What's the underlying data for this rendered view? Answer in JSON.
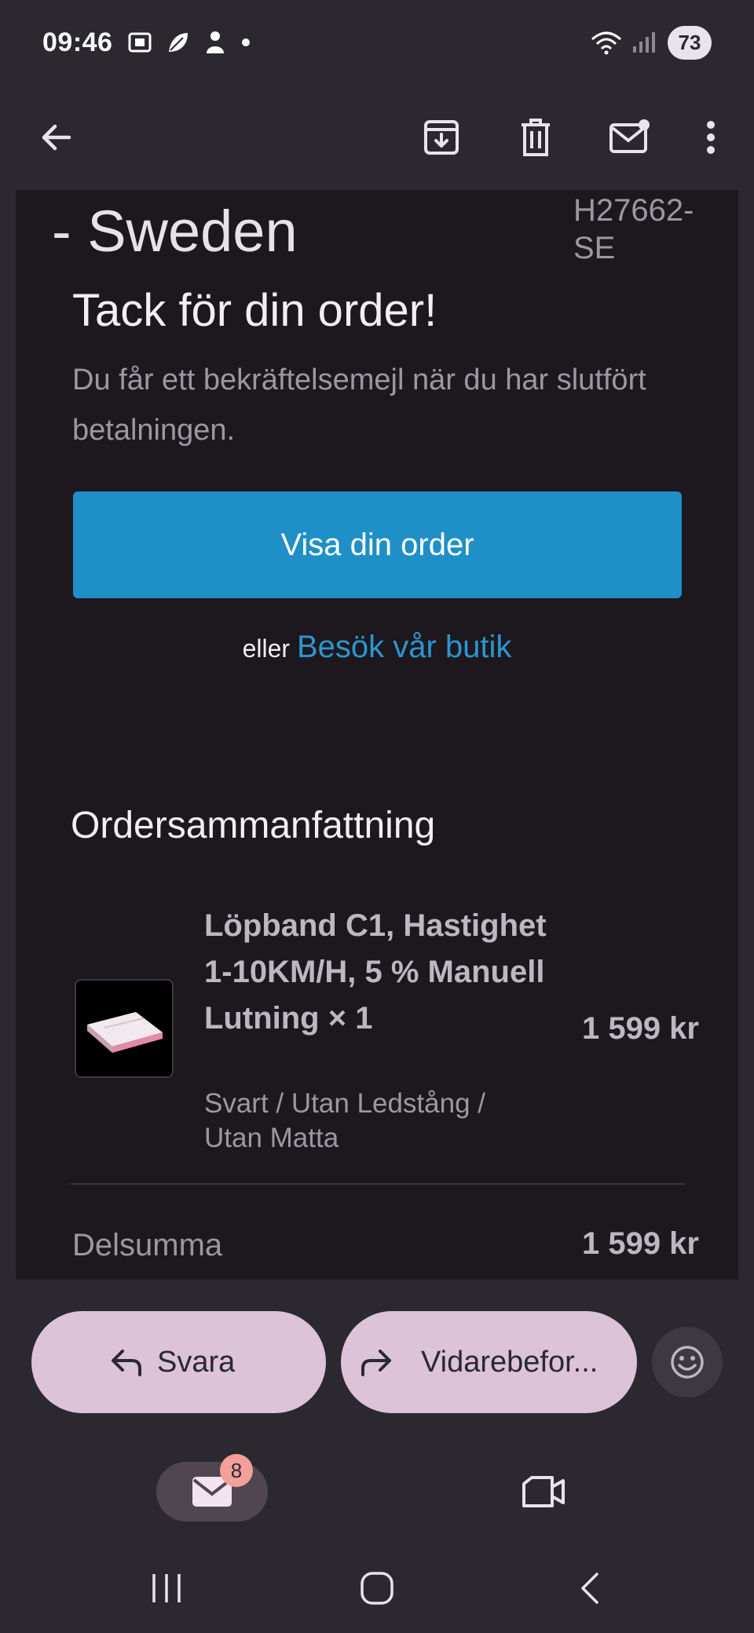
{
  "status_bar": {
    "time": "09:46",
    "battery": "73"
  },
  "app_bar": {
    "icons": [
      "back-arrow-icon",
      "archive-icon",
      "delete-icon",
      "mark-unread-icon",
      "more-options-icon"
    ]
  },
  "email": {
    "store_name": "- Sweden",
    "order_ref": "H27662-SE",
    "heading": "Tack för din order!",
    "info": "Du får ett bekräftelsemejl när du har slutfört betalningen.",
    "cta_label": "Visa din order",
    "alt_prefix": "eller",
    "alt_link": "Besök vår butik",
    "summary_title": "Ordersammanfattning",
    "product": {
      "name": "Löpband C1, Hastighet 1-10KM/H, 5 % Manuell Lutning × 1",
      "variant": "Svart / Utan Ledstång / Utan Matta",
      "price": "1 599 kr"
    },
    "subtotal_label": "Delsumma",
    "subtotal_value": "1 599 kr"
  },
  "reply_bar": {
    "reply_label": "Svara",
    "forward_label": "Vidarebefor..."
  },
  "bottom_nav": {
    "mail_badge": "8"
  },
  "colors": {
    "background": "#2b2830",
    "email_background": "#1c181d",
    "cta": "#1f8fc8",
    "link": "#2d95cf",
    "pill": "#dcc3d8",
    "badge": "#f4a09a"
  }
}
